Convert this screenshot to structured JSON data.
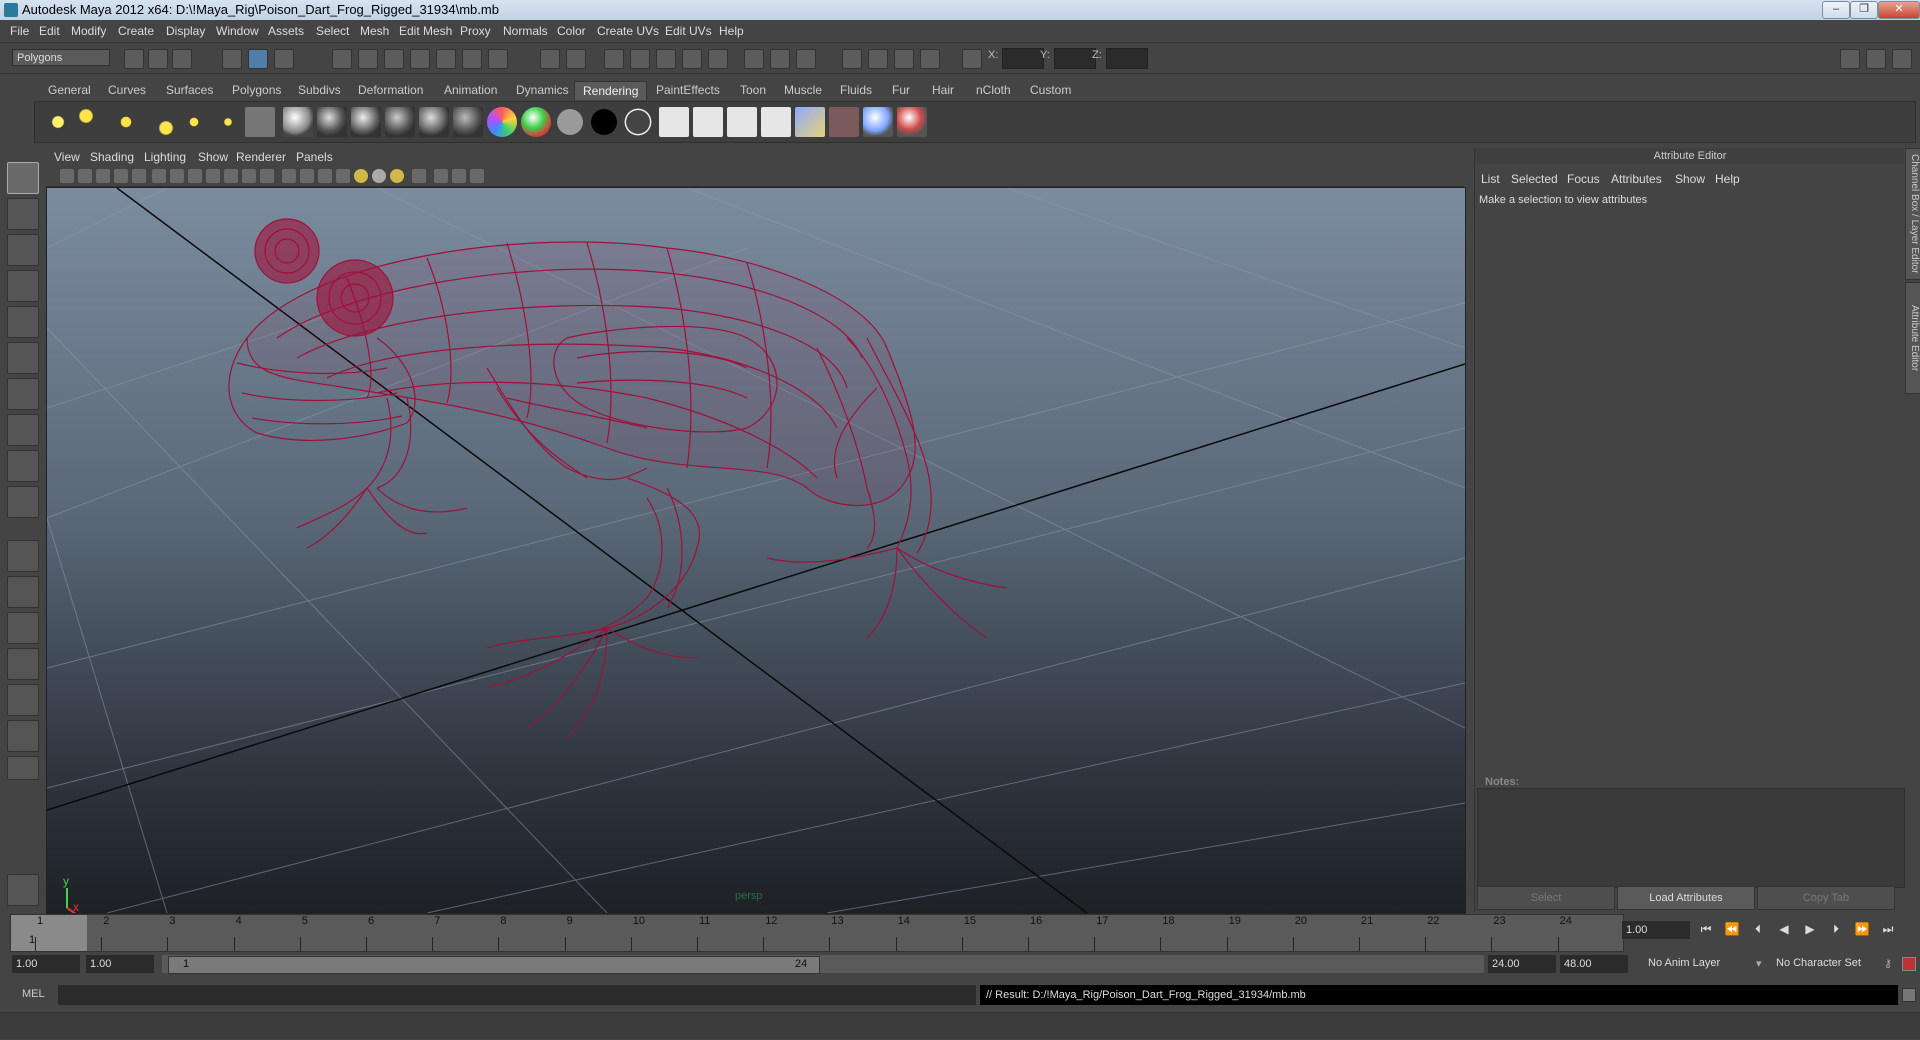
{
  "window": {
    "title": "Autodesk Maya 2012 x64: D:\\!Maya_Rig\\Poison_Dart_Frog_Rigged_31934\\mb.mb",
    "controls": [
      "–",
      "❐",
      "✕"
    ]
  },
  "menubar": [
    "File",
    "Edit",
    "Modify",
    "Create",
    "Display",
    "Window",
    "Assets",
    "Select",
    "Mesh",
    "Edit Mesh",
    "Proxy",
    "Normals",
    "Color",
    "Create UVs",
    "Edit UVs",
    "Help"
  ],
  "status_line": {
    "mode": "Polygons",
    "x_label": "X:",
    "y_label": "Y:",
    "z_label": "Z:"
  },
  "shelf_tabs": [
    "General",
    "Curves",
    "Surfaces",
    "Polygons",
    "Subdivs",
    "Deformation",
    "Animation",
    "Dynamics",
    "Rendering",
    "PaintEffects",
    "Toon",
    "Muscle",
    "Fluids",
    "Fur",
    "Hair",
    "nCloth",
    "Custom"
  ],
  "active_shelf_tab": "Rendering",
  "viewport": {
    "menu": [
      "View",
      "Shading",
      "Lighting",
      "Show",
      "Renderer",
      "Panels"
    ],
    "camera_label": "persp",
    "axis_y": "y",
    "axis_x": "x",
    "wireframe_color": "#a0103a"
  },
  "attribute_editor": {
    "title": "Attribute Editor",
    "menu": [
      "List",
      "Selected",
      "Focus",
      "Attributes",
      "Show",
      "Help"
    ],
    "message": "Make a selection to view attributes",
    "notes_label": "Notes:",
    "buttons": {
      "select": "Select",
      "load": "Load Attributes",
      "copy": "Copy Tab"
    },
    "side_tabs": [
      "Channel Box / Layer Editor",
      "Attribute Editor"
    ]
  },
  "timeline": {
    "ticks": [
      "1",
      "2",
      "3",
      "4",
      "5",
      "6",
      "7",
      "8",
      "9",
      "10",
      "11",
      "12",
      "13",
      "14",
      "15",
      "16",
      "17",
      "18",
      "19",
      "20",
      "21",
      "22",
      "23",
      "24"
    ],
    "current_frame": "1",
    "current_frame_field": "1.00"
  },
  "range": {
    "start_time": "1.00",
    "playback_start": "1.00",
    "slider_start": "1",
    "slider_end": "24",
    "playback_end": "24.00",
    "end_time": "48.00",
    "anim_layer": "No Anim Layer",
    "character_set": "No Character Set"
  },
  "command_line": {
    "label": "MEL",
    "result": "// Result: D:/!Maya_Rig/Poison_Dart_Frog_Rigged_31934/mb.mb"
  }
}
